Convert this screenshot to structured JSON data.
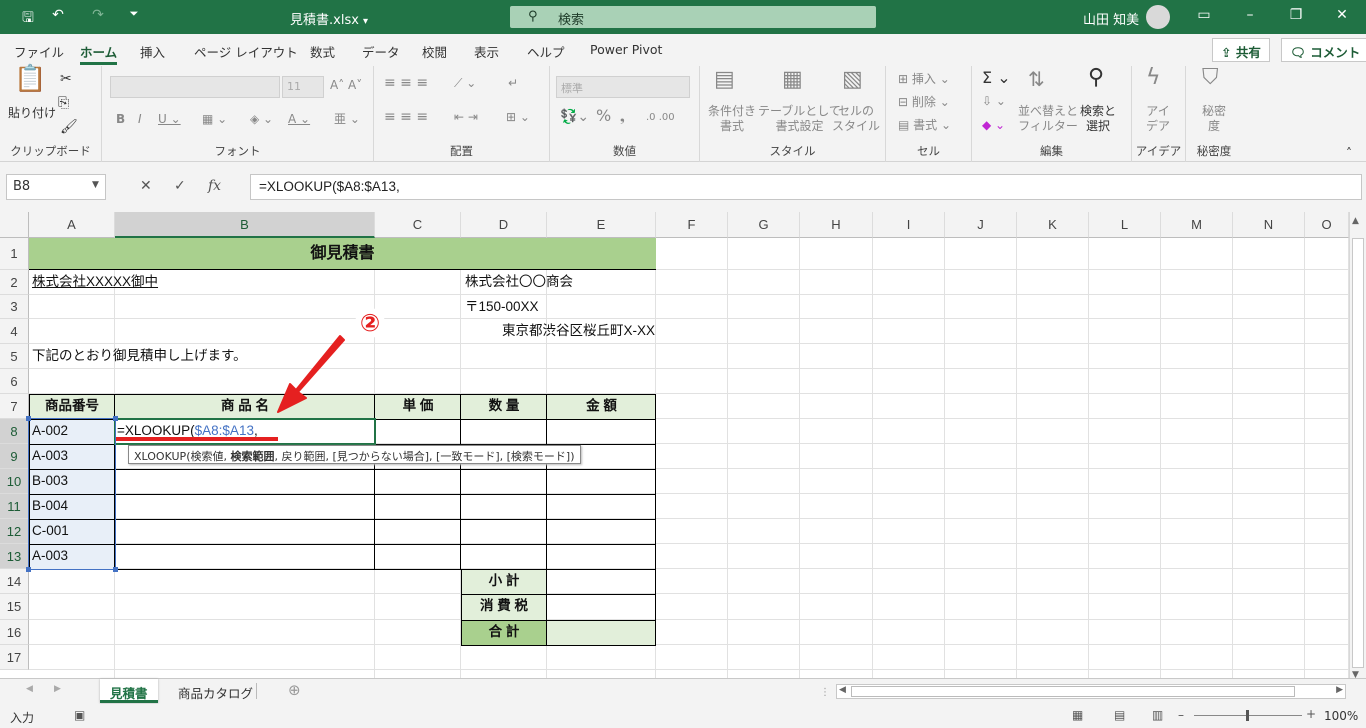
{
  "title": {
    "filename": "見積書.xlsx",
    "search_placeholder": "検索",
    "user": "山田 知美",
    "dropdown_glyph": "▾"
  },
  "menu_tabs": [
    "ファイル",
    "ホーム",
    "挿入",
    "ページ レイアウト",
    "数式",
    "データ",
    "校閲",
    "表示",
    "ヘルプ",
    "Power Pivot"
  ],
  "share_label": "共有",
  "comment_label": "コメント",
  "ribbon": {
    "clipboard": {
      "label": "クリップボード",
      "paste": "貼り付け"
    },
    "font": {
      "label": "フォント",
      "size": "11"
    },
    "alignment": {
      "label": "配置"
    },
    "number": {
      "label": "数値",
      "format": "標準"
    },
    "styles": {
      "label": "スタイル",
      "conditional": "条件付き\n書式",
      "table": "テーブルとして\n書式設定",
      "cell_styles": "セルの\nスタイル"
    },
    "cells": {
      "label": "セル",
      "insert": "挿入",
      "delete": "削除",
      "format": "書式"
    },
    "editing": {
      "label": "編集",
      "sort": "並べ替えと\nフィルター",
      "find": "検索と\n選択"
    },
    "ideas": {
      "label": "アイデア",
      "btn": "アイ\nデア"
    },
    "sensitivity": {
      "label": "秘密度",
      "btn": "秘密\n度"
    }
  },
  "formula_bar": {
    "name_box": "B8",
    "formula": "=XLOOKUP($A8:$A13,"
  },
  "columns": [
    "A",
    "B",
    "C",
    "D",
    "E",
    "F",
    "G",
    "H",
    "I",
    "J",
    "K",
    "L",
    "M",
    "N",
    "O"
  ],
  "rows": [
    "1",
    "2",
    "3",
    "4",
    "5",
    "6",
    "7",
    "8",
    "9",
    "10",
    "11",
    "12",
    "13",
    "14",
    "15",
    "16",
    "17"
  ],
  "cells": {
    "title": "御見積書",
    "client": "株式会社XXXXX御中",
    "company": "株式会社〇〇商会",
    "postal": "〒150-00XX",
    "address": "東京都渋谷区桜丘町X-XX",
    "intro": "下記のとおり御見積申し上げます。",
    "hdr_code": "商品番号",
    "hdr_name": "商 品 名",
    "hdr_price": "単 価",
    "hdr_qty": "数 量",
    "hdr_amount": "金 額",
    "codes": [
      "A-002",
      "A-003",
      "B-003",
      "B-004",
      "C-001",
      "A-003"
    ],
    "edit_prefix": "=XLOOKUP(",
    "edit_ref": "$A8:$A13",
    "edit_suffix": ",",
    "subtotal": "小 計",
    "tax": "消 費 税",
    "total": "合 計"
  },
  "tooltip": {
    "before": "XLOOKUP(検索値, ",
    "bold": "検索範囲",
    "after": ", 戻り範囲, [見つからない場合], [一致モード], [検索モード])"
  },
  "annotation": {
    "number": "②"
  },
  "sheets": [
    "見積書",
    "商品カタログ"
  ],
  "status": {
    "mode": "入力",
    "zoom": "100%"
  },
  "colors": {
    "excel_green": "#217346",
    "title_fill": "#a9d08e",
    "header_fill": "#e2efda",
    "total_fill": "#a9d08e",
    "ref_blue": "#4472c4",
    "arrow_red": "#e52020"
  }
}
